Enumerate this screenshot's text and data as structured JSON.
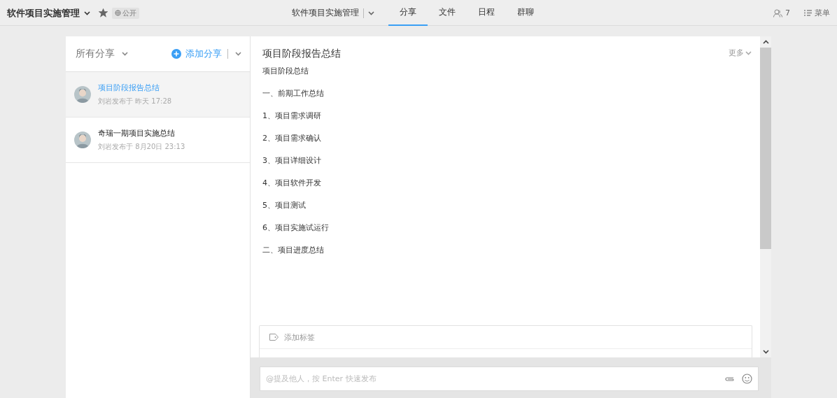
{
  "project": {
    "title": "软件项目实施管理",
    "visibility": "公开",
    "starred": true
  },
  "nav": {
    "project_switch": "软件项目实施管理",
    "tabs": [
      {
        "label": "分享",
        "selected": true
      },
      {
        "label": "文件",
        "selected": false
      },
      {
        "label": "日程",
        "selected": false
      },
      {
        "label": "群聊",
        "selected": false
      }
    ]
  },
  "members": {
    "count": "7"
  },
  "menu": {
    "label": "菜单"
  },
  "list": {
    "filter": "所有分享",
    "add": "添加分享",
    "items": [
      {
        "title": "项目阶段报告总结",
        "meta": "刘岩发布于 昨天 17:28",
        "selected": true
      },
      {
        "title": "奇瑞一期项目实施总结",
        "meta": "刘岩发布于 8月20日 23:13",
        "selected": false
      }
    ]
  },
  "detail": {
    "title": "项目阶段报告总结",
    "more": "更多",
    "lines": [
      "项目阶段总结",
      "一、前期工作总结",
      "1、项目需求调研",
      "2、项目需求确认",
      "3、项目详细设计",
      "4、项目软件开发",
      "5、项目测试",
      "6、项目实施试运行",
      "二、项目进度总结"
    ],
    "tag_placeholder": "添加标签"
  },
  "composer": {
    "placeholder": "@提及他人，按 Enter 快速发布"
  }
}
